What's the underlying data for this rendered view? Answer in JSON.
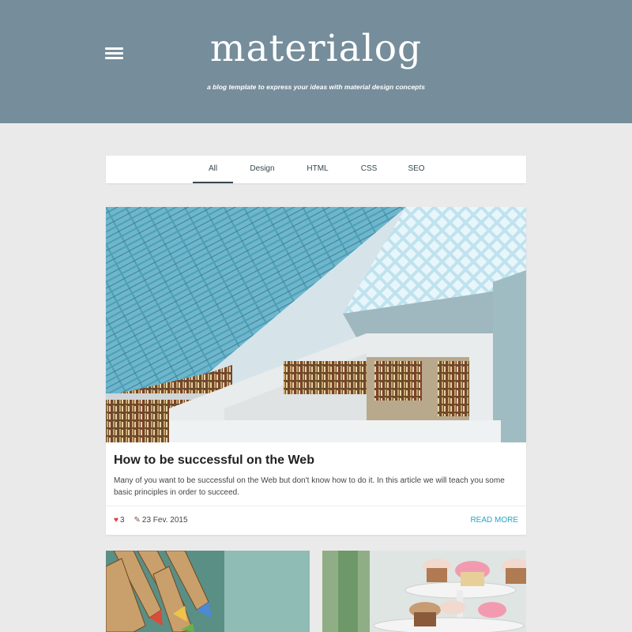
{
  "header": {
    "logo": "materialog",
    "tagline": "a blog template to express your ideas with material design concepts",
    "menu_icon": "hamburger-menu-icon",
    "bg_color": "#768d9b"
  },
  "tabs": [
    {
      "label": "All",
      "active": true
    },
    {
      "label": "Design",
      "active": false
    },
    {
      "label": "HTML",
      "active": false
    },
    {
      "label": "CSS",
      "active": false
    },
    {
      "label": "SEO",
      "active": false
    }
  ],
  "featured_post": {
    "image": "library-interior-photo",
    "title": "How to be successful on the Web",
    "excerpt": "Many of you want to be successful on the Web but don't know how to do it. In this article we will teach you some basic principles in order to succeed.",
    "likes": "3",
    "date": "23 Fev. 2015",
    "read_more": "READ MORE",
    "accent_color": "#26a6c4"
  },
  "more_posts": [
    {
      "image": "colored-pencils-photo"
    },
    {
      "image": "cupcakes-photo"
    }
  ]
}
